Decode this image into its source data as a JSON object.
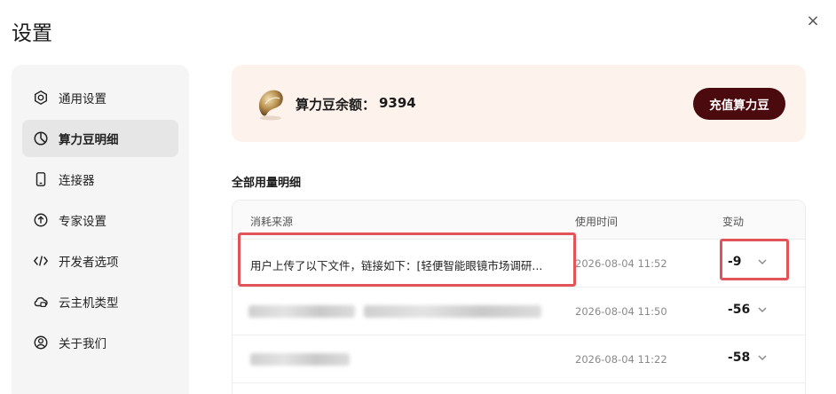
{
  "window": {
    "title": "设置",
    "close_label": "×"
  },
  "sidebar": {
    "items": [
      {
        "label": "通用设置",
        "icon": "settings-hex-icon"
      },
      {
        "label": "算力豆明细",
        "icon": "pie-chart-icon",
        "active": true
      },
      {
        "label": "连接器",
        "icon": "phone-icon"
      },
      {
        "label": "专家设置",
        "icon": "upload-circle-icon"
      },
      {
        "label": "开发者选项",
        "icon": "code-icon"
      },
      {
        "label": "云主机类型",
        "icon": "cloud-icon"
      },
      {
        "label": "关于我们",
        "icon": "user-circle-icon"
      }
    ]
  },
  "balance": {
    "label": "算力豆余额：",
    "value": "9394",
    "recharge_label": "充值算力豆"
  },
  "section": {
    "title": "全部用量明细"
  },
  "table": {
    "headers": {
      "source": "消耗来源",
      "time": "使用时间",
      "change": "变动"
    },
    "rows": [
      {
        "source": "用户上传了以下文件，链接如下：[轻便智能眼镜市场调研...",
        "time": "2026-08-04 11:52",
        "change": "-9"
      },
      {
        "source": "",
        "time": "2026-08-04 11:50",
        "change": "-56"
      },
      {
        "source": "",
        "time": "2026-08-04 11:22",
        "change": "-58"
      }
    ]
  },
  "colors": {
    "accent_dark": "#4a0a0e",
    "balance_bg": "#fdf3ec",
    "highlight": "#e0545a"
  }
}
